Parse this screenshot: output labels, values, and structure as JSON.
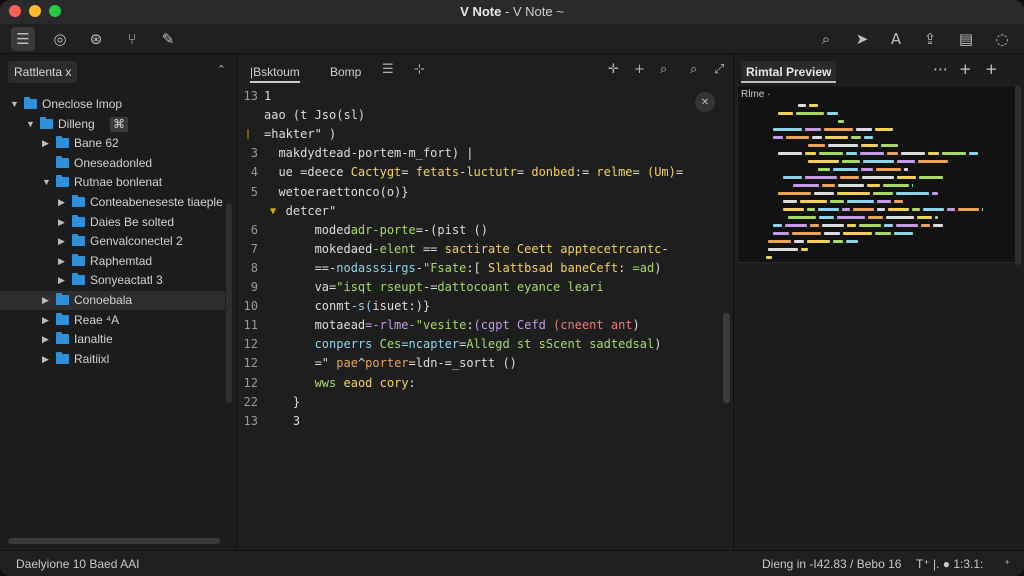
{
  "window": {
    "title_bold": "V Note",
    "title_rest": " - V Note ~"
  },
  "toolbar": {
    "left_icons": [
      "list-icon",
      "globe-icon",
      "history-icon",
      "branch-icon",
      "pin-icon"
    ],
    "right_icons": [
      "search-icon",
      "send-icon",
      "font-icon",
      "share-icon",
      "archive-icon",
      "chat-icon"
    ]
  },
  "sidebar": {
    "tab_label": "Rattlenta x",
    "items": [
      {
        "label": "Oneclose lmop",
        "level": 0,
        "arrow": "▼"
      },
      {
        "label": "Dilleng",
        "level": 1,
        "arrow": "▼",
        "badge": "⌘"
      },
      {
        "label": "Bane 62",
        "level": 2,
        "arrow": "▶"
      },
      {
        "label": "Oneseadonled",
        "level": 2,
        "arrow": ""
      },
      {
        "label": "Rutnae bonlenat",
        "level": 2,
        "arrow": "▼"
      },
      {
        "label": "Conteabeneseste tiaeple",
        "level": 3,
        "arrow": "▶"
      },
      {
        "label": "Daies Be solted",
        "level": 3,
        "arrow": "▶"
      },
      {
        "label": "Genvalconectel 2",
        "level": 3,
        "arrow": "▶"
      },
      {
        "label": "Raphemtad",
        "level": 3,
        "arrow": "▶"
      },
      {
        "label": "Sonyeactatl 3",
        "level": 3,
        "arrow": "▶"
      },
      {
        "label": "Conoebala",
        "level": 2,
        "arrow": "▶",
        "selected": true
      },
      {
        "label": "Reae ⁴A",
        "level": 2,
        "arrow": "▶"
      },
      {
        "label": "Ianaltie",
        "level": 2,
        "arrow": "▶"
      },
      {
        "label": "Raitiixl",
        "level": 2,
        "arrow": "▶"
      }
    ]
  },
  "editor": {
    "tabs": [
      {
        "label": "|Bsktoum",
        "active": true
      },
      {
        "label": "Bomp",
        "active": false
      }
    ],
    "lines": [
      {
        "n": "13",
        "segs": [
          [
            "c-w",
            "1"
          ]
        ]
      },
      {
        "n": "",
        "segs": [
          [
            "c-w",
            "aao (t Jso(sl)"
          ]
        ]
      },
      {
        "n": "",
        "mark": "|",
        "segs": [
          [
            "c-w",
            "=hakter\" )"
          ]
        ]
      },
      {
        "n": "3",
        "segs": [
          [
            "c-w",
            "  makdydtead-portem-m_fort) |"
          ]
        ]
      },
      {
        "n": "4",
        "segs": [
          [
            "c-w",
            "  ue =deece "
          ],
          [
            "c-y",
            "Cactygt"
          ],
          [
            "c-w",
            "= "
          ],
          [
            "c-y",
            "fetats"
          ],
          [
            "c-w",
            "-"
          ],
          [
            "c-y",
            "luctutr"
          ],
          [
            "c-w",
            "= "
          ],
          [
            "c-y",
            "donbed"
          ],
          [
            "c-w",
            ":= "
          ],
          [
            "c-y",
            "relme"
          ],
          [
            "c-w",
            "= "
          ],
          [
            "c-y",
            "(Um)"
          ],
          [
            "c-w",
            "="
          ]
        ]
      },
      {
        "n": "5",
        "segs": [
          [
            "c-w",
            "  wetoeraettonco(o)}"
          ]
        ]
      },
      {
        "n": "",
        "fold": "▼",
        "segs": [
          [
            "c-w",
            "   detcer\""
          ]
        ]
      },
      {
        "n": "6",
        "segs": [
          [
            "c-w",
            "       moded"
          ],
          [
            "c-g",
            "adr-porte"
          ],
          [
            "c-w",
            "=-(pist ()"
          ]
        ]
      },
      {
        "n": "7",
        "segs": [
          [
            "c-w",
            "       mokedaed"
          ],
          [
            "c-g",
            "-elent"
          ],
          [
            "c-w",
            " == "
          ],
          [
            "c-y",
            "sactirate Ceett"
          ],
          [
            "c-w",
            " "
          ],
          [
            "c-y",
            "apptecetrcantc"
          ],
          [
            "c-w",
            "-"
          ]
        ]
      },
      {
        "n": "8",
        "segs": [
          [
            "c-w",
            "       ==-"
          ],
          [
            "c-c",
            "nodasssirgs"
          ],
          [
            "c-w",
            "-"
          ],
          [
            "c-g",
            "\"Fsate"
          ],
          [
            "c-w",
            ":[ "
          ],
          [
            "c-y",
            "Slattbsad"
          ],
          [
            "c-w",
            " "
          ],
          [
            "c-y",
            "baneCeft"
          ],
          [
            "c-w",
            ": "
          ],
          [
            "c-g",
            "=ad"
          ],
          [
            "c-w",
            ")"
          ]
        ]
      },
      {
        "n": "9",
        "segs": [
          [
            "c-w",
            "       va="
          ],
          [
            "c-g",
            "\"isqt"
          ],
          [
            "c-w",
            " "
          ],
          [
            "c-g",
            "rseupt"
          ],
          [
            "c-w",
            "-="
          ],
          [
            "c-g",
            "dattocoant"
          ],
          [
            "c-w",
            " "
          ],
          [
            "c-g",
            "eyance"
          ],
          [
            "c-w",
            " "
          ],
          [
            "c-g",
            "leari"
          ]
        ]
      },
      {
        "n": "10",
        "segs": [
          [
            "c-w",
            "       conmt"
          ],
          [
            "c-c",
            "-s("
          ],
          [
            "c-w",
            "isuet:)}"
          ]
        ]
      },
      {
        "n": "11",
        "segs": [
          [
            "c-w",
            "       motaead"
          ],
          [
            "c-p",
            "=-rlme-"
          ],
          [
            "c-g",
            "\"vesite"
          ],
          [
            "c-w",
            ":"
          ],
          [
            "c-p",
            "(cgpt"
          ],
          [
            "c-w",
            " "
          ],
          [
            "c-p",
            "Cefd"
          ],
          [
            "c-w",
            " "
          ],
          [
            "c-r",
            "(cneent"
          ],
          [
            "c-w",
            " "
          ],
          [
            "c-r",
            "ant"
          ],
          [
            "c-w",
            ")"
          ]
        ]
      },
      {
        "n": "12",
        "segs": [
          [
            "c-w",
            "       "
          ],
          [
            "c-c",
            "conperrs"
          ],
          [
            "c-w",
            " "
          ],
          [
            "c-g",
            "Ces"
          ],
          [
            "c-c",
            "=ncapter"
          ],
          [
            "c-w",
            "="
          ],
          [
            "c-g",
            "Allegd"
          ],
          [
            "c-w",
            " "
          ],
          [
            "c-g",
            "st"
          ],
          [
            "c-w",
            " "
          ],
          [
            "c-g",
            "sScent"
          ],
          [
            "c-w",
            " "
          ],
          [
            "c-g",
            "sadtedsal"
          ],
          [
            "c-w",
            ")"
          ]
        ]
      },
      {
        "n": "12",
        "segs": [
          [
            "c-w",
            "       =\" "
          ],
          [
            "c-o",
            "pae"
          ],
          [
            "c-w",
            "^"
          ],
          [
            "c-o",
            "porter"
          ],
          [
            "c-w",
            "=ldn-=_sortt ()"
          ]
        ]
      },
      {
        "n": "12",
        "segs": [
          [
            "c-w",
            "       "
          ],
          [
            "c-g",
            "wws"
          ],
          [
            "c-w",
            " "
          ],
          [
            "c-y",
            "eaod"
          ],
          [
            "c-w",
            " "
          ],
          [
            "c-y",
            "cory"
          ],
          [
            "c-w",
            ":"
          ]
        ]
      },
      {
        "n": "22",
        "segs": [
          [
            "c-w",
            "    }"
          ]
        ]
      },
      {
        "n": "13",
        "segs": [
          [
            "c-w",
            "    3"
          ]
        ]
      }
    ]
  },
  "preview": {
    "title": "Rimtal Preview",
    "frame_tab": "Rlme ·"
  },
  "status": {
    "left": "Daelyione 10   Baed AAI",
    "right_a": "Dieng in -I42.83 / Bebo 16",
    "right_b": "T⁺ |. ● 1:3.1:",
    "right_c": "⁺"
  }
}
